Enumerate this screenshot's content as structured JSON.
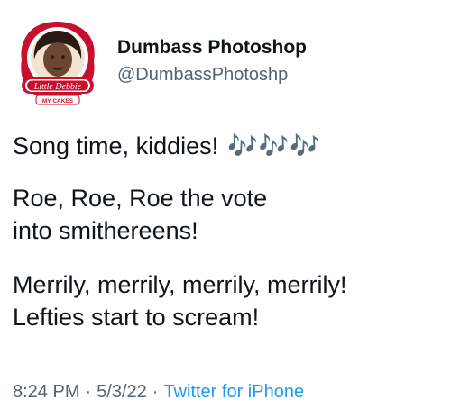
{
  "author": {
    "display_name": "Dumbass Photoshop",
    "handle": "@DumbassPhotoshp",
    "avatar": {
      "logo_text": "Little Debbie",
      "logo_subtext": "MY CAKES",
      "ring_color": "#c8102e"
    }
  },
  "tweet": {
    "paragraphs": [
      [
        "Song time, kiddies!"
      ],
      [
        "Roe, Roe, Roe the vote",
        "into smithereens!"
      ],
      [
        "Merrily, merrily, merrily, merrily!",
        "Lefties start to scream!"
      ]
    ],
    "emoji": "🎶🎶🎶",
    "emoji_name": "musical-notes-icon"
  },
  "footer": {
    "time": "8:24 PM",
    "separator": "·",
    "date": "5/3/22",
    "source": "Twitter for iPhone"
  },
  "colors": {
    "text": "#0f1419",
    "secondary": "#536471",
    "link": "#1d9bf0"
  }
}
